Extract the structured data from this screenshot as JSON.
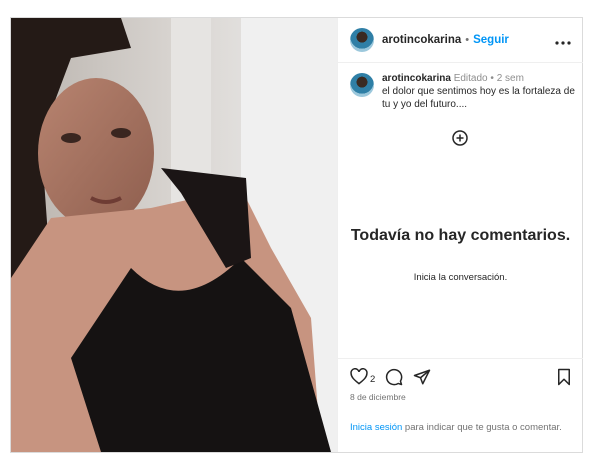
{
  "post": {
    "username": "arotincokarina",
    "follow_label": "Seguir",
    "header_separator": "•",
    "more_label": "•••"
  },
  "caption": {
    "username": "arotincokarina",
    "edited": "Editado",
    "separator": "•",
    "age": "2 sem",
    "text": "el dolor que sentimos hoy es la fortaleza de tu y yo del futuro...."
  },
  "comments": {
    "empty_title": "Todavía no hay comentarios.",
    "empty_subtitle": "Inicia la conversación."
  },
  "actions": {
    "like_count": "2",
    "date": "8 de diciembre",
    "login_link": "Inicia sesión",
    "login_text": " para indicar que te gusta o comentar."
  },
  "icons": {
    "more": "more-options-icon",
    "add": "add-circle-icon",
    "like": "heart-icon",
    "comment": "comment-icon",
    "share": "share-icon",
    "save": "bookmark-icon"
  },
  "colors": {
    "link": "#0095f6",
    "secondary_text": "#737373",
    "border": "#dbdbdb"
  }
}
